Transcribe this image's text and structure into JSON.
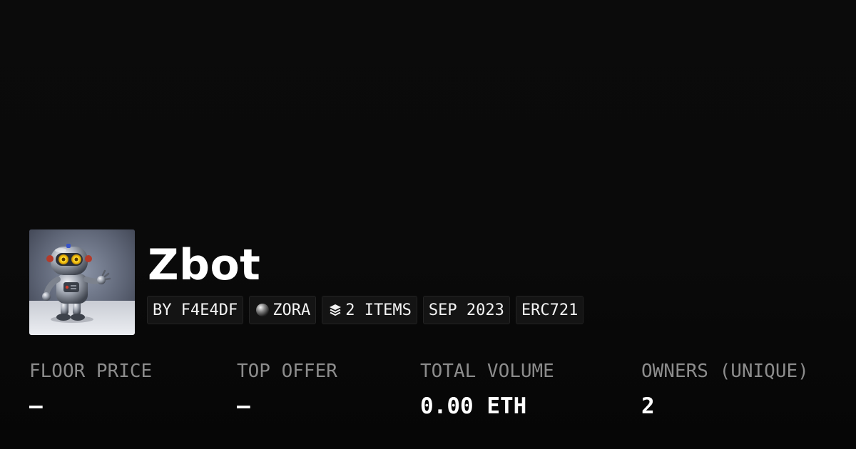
{
  "collection": {
    "name": "Zbot",
    "avatar_icon": "robot-avatar-image"
  },
  "chips": {
    "creator": "BY F4E4DF",
    "network": "ZORA",
    "network_icon": "zora-orb-icon",
    "items": "2 ITEMS",
    "items_icon": "layers-icon",
    "date": "SEP 2023",
    "standard": "ERC721"
  },
  "stats": {
    "floor_price_label": "FLOOR PRICE",
    "floor_price_value": "–",
    "top_offer_label": "TOP OFFER",
    "top_offer_value": "–",
    "total_volume_label": "TOTAL VOLUME",
    "total_volume_value": "0.00 ETH",
    "owners_label": "OWNERS (UNIQUE)",
    "owners_value": "2"
  },
  "colors": {
    "background": "#0a0a0a",
    "chip_background": "#141414",
    "label_gray": "#8c8c8c",
    "text": "#ffffff"
  }
}
